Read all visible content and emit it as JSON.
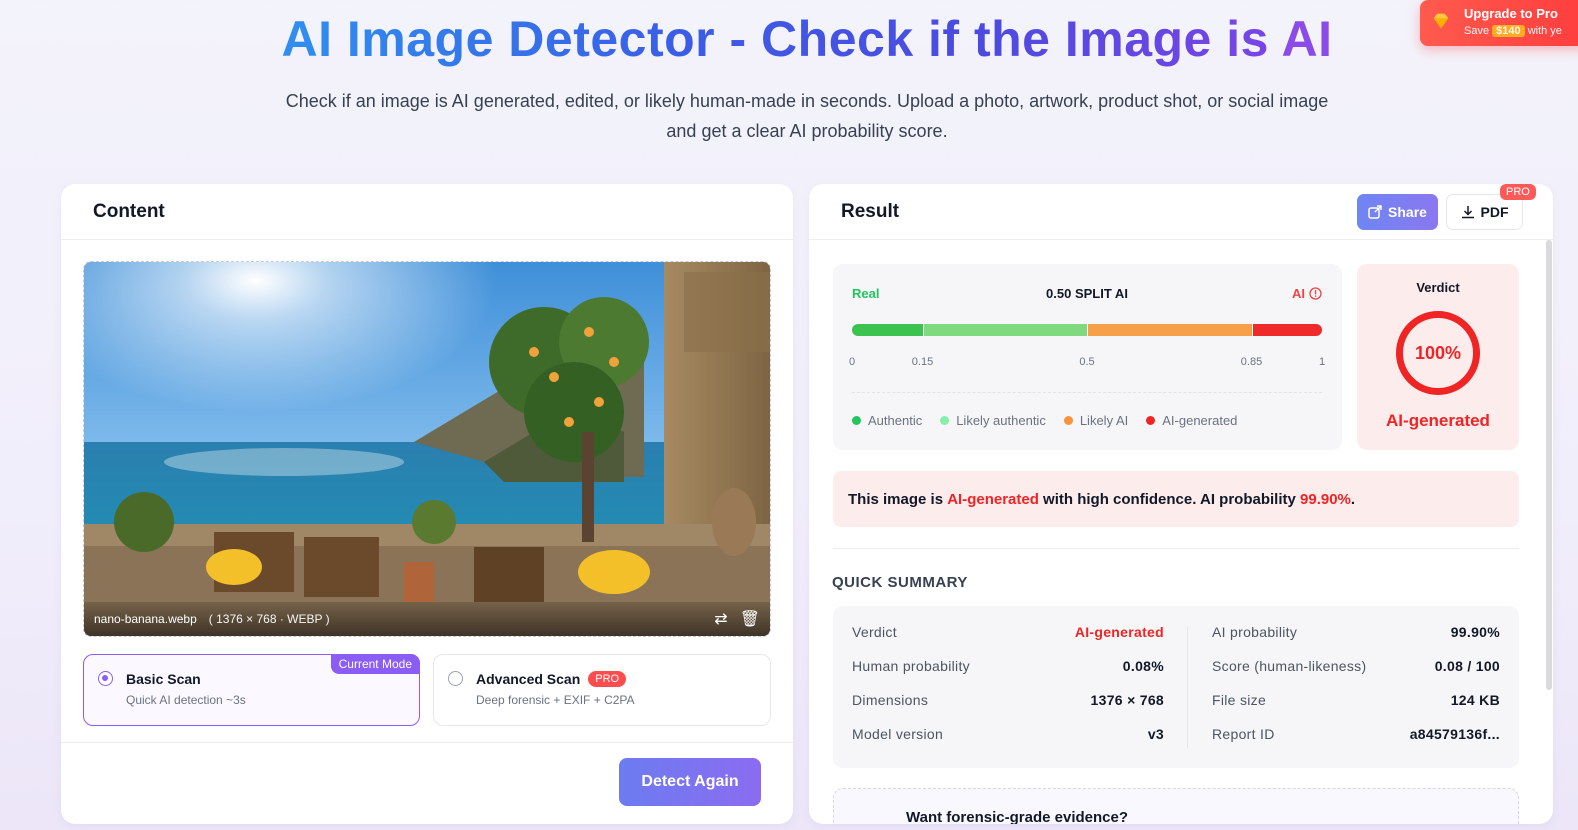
{
  "hero": {
    "title_main": "AI Image Detector - Check if the Image is ",
    "title_end": "AI",
    "subtitle": "Check if an image is AI generated, edited, or likely human-made in seconds. Upload a photo, artwork, product shot, or social image and get a clear AI probability score."
  },
  "upgrade": {
    "title": "Upgrade to Pro",
    "save_prefix": "Save",
    "save_amount": "$140",
    "save_suffix": "with ye"
  },
  "content": {
    "title": "Content",
    "file_name": "nano-banana.webp",
    "file_dims": "( 1376 × 768 · WEBP )",
    "swap_icon": "⇄",
    "trash_icon": "🗑",
    "modes": {
      "basic": {
        "title": "Basic Scan",
        "subtitle": "Quick AI detection ~3s",
        "badge": "Current Mode"
      },
      "advanced": {
        "title": "Advanced Scan",
        "subtitle": "Deep forensic + EXIF + C2PA",
        "badge": "PRO"
      }
    },
    "detect_label": "Detect Again"
  },
  "result": {
    "title": "Result",
    "share_label": "Share",
    "pdf_label": "PDF",
    "pdf_badge": "PRO",
    "scale": {
      "left_label": "Real",
      "mid_label": "0.50 SPLIT AI",
      "right_label": "AI",
      "ticks": [
        {
          "label": "0",
          "value": 0
        },
        {
          "label": "0.15",
          "value": 0.15
        },
        {
          "label": "0.5",
          "value": 0.5
        },
        {
          "label": "0.85",
          "value": 0.85
        },
        {
          "label": "1",
          "value": 1
        }
      ],
      "segments": [
        {
          "from": 0,
          "to": 0.15,
          "color": "#3cc24e"
        },
        {
          "from": 0.15,
          "to": 0.5,
          "color": "#7fd97f"
        },
        {
          "from": 0.5,
          "to": 0.85,
          "color": "#f6a14a"
        },
        {
          "from": 0.85,
          "to": 1,
          "color": "#ee2a2a"
        }
      ],
      "legend": [
        {
          "label": "Authentic",
          "color": "#22c55e"
        },
        {
          "label": "Likely authentic",
          "color": "#86efac"
        },
        {
          "label": "Likely AI",
          "color": "#fb923c"
        },
        {
          "label": "AI-generated",
          "color": "#ef2424"
        }
      ]
    },
    "verdict": {
      "title": "Verdict",
      "percent": "100%",
      "label": "AI-generated"
    },
    "confidence": {
      "prefix": "This image is ",
      "verdict": "AI-generated",
      "middle": " with high confidence. AI probability ",
      "probability": "99.90%",
      "suffix": "."
    },
    "summary_title": "QUICK SUMMARY",
    "summary_left": [
      {
        "label": "Verdict",
        "value": "AI-generated",
        "red": true
      },
      {
        "label": "Human probability",
        "value": "0.08%"
      },
      {
        "label": "Dimensions",
        "value": "1376 × 768"
      },
      {
        "label": "Model version",
        "value": "v3"
      }
    ],
    "summary_right": [
      {
        "label": "AI probability",
        "value": "99.90%"
      },
      {
        "label": "Score (human-likeness)",
        "value": "0.08 / 100"
      },
      {
        "label": "File size",
        "value": "124 KB"
      },
      {
        "label": "Report ID",
        "value": "a84579136f..."
      }
    ],
    "forensic_prompt": "Want forensic-grade evidence?"
  }
}
